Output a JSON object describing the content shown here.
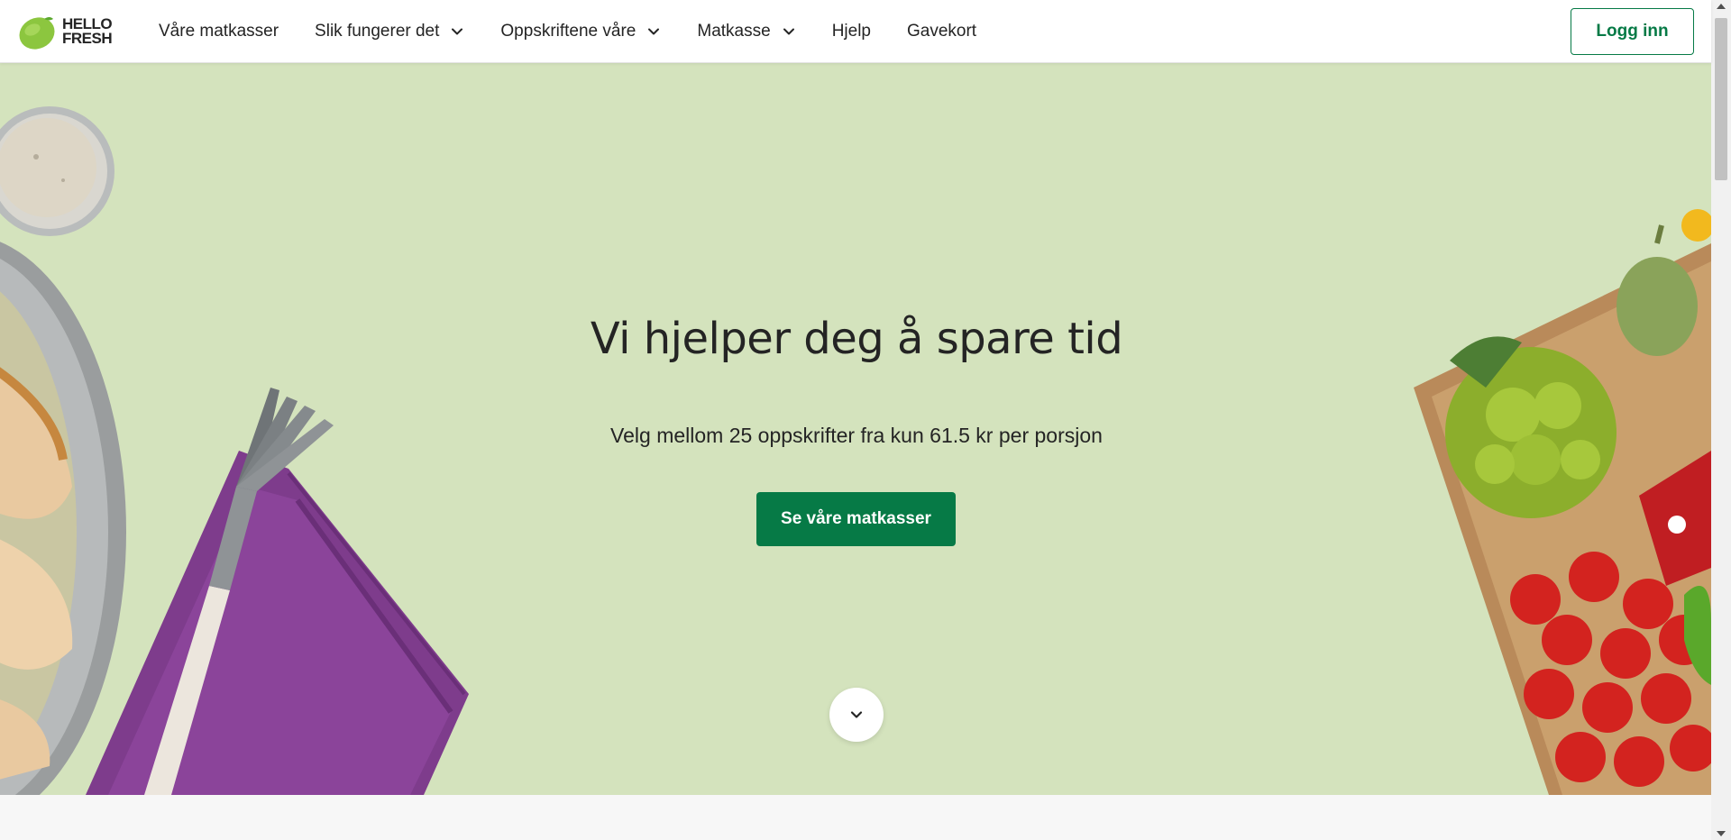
{
  "brand": {
    "logo_line1": "HELLO",
    "logo_line2": "FRESH",
    "primary_color": "#067a46",
    "lime_color": "#8cc63f",
    "hero_bg": "#d4e3bd"
  },
  "nav": {
    "items": [
      {
        "label": "Våre matkasser",
        "has_dropdown": false
      },
      {
        "label": "Slik fungerer det",
        "has_dropdown": true
      },
      {
        "label": "Oppskriftene våre",
        "has_dropdown": true
      },
      {
        "label": "Matkasse",
        "has_dropdown": true
      },
      {
        "label": "Hjelp",
        "has_dropdown": false
      },
      {
        "label": "Gavekort",
        "has_dropdown": false
      }
    ],
    "login_label": "Logg inn"
  },
  "hero": {
    "title": "Vi hjelper deg å spare tid",
    "subtitle": "Velg mellom 25 oppskrifter fra kun 61.5 kr per porsjon",
    "cta_label": "Se våre matkasser"
  },
  "icons": {
    "dropdown": "chevron-down-icon",
    "scroll": "chevron-down-icon"
  }
}
